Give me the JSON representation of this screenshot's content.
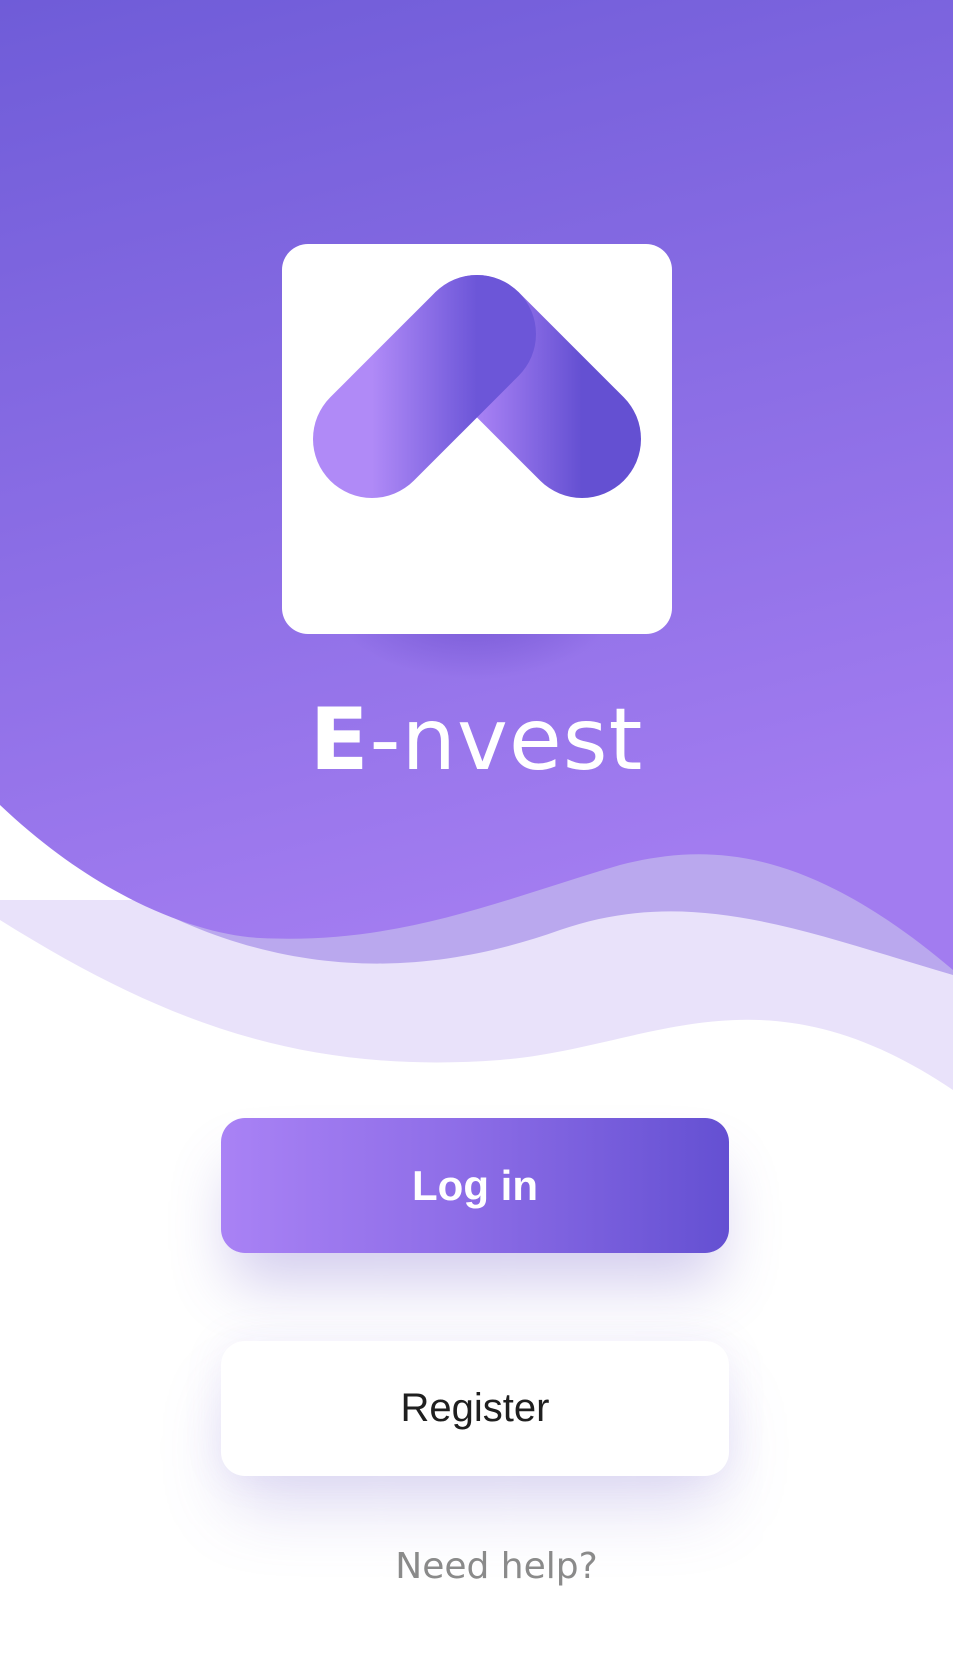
{
  "brand": {
    "bold_letter": "E",
    "rest": "-nvest"
  },
  "actions": {
    "login_label": "Log in",
    "register_label": "Register",
    "help_label": "Need help?"
  },
  "colors": {
    "header_top": "#6f5cd8",
    "header_bottom": "#a27cf0",
    "accent_light": "#a982f5",
    "accent_dark": "#6450d2",
    "help_text": "#8a8a8a"
  },
  "icons": {
    "app_logo": "chevron-up-logo-icon"
  }
}
